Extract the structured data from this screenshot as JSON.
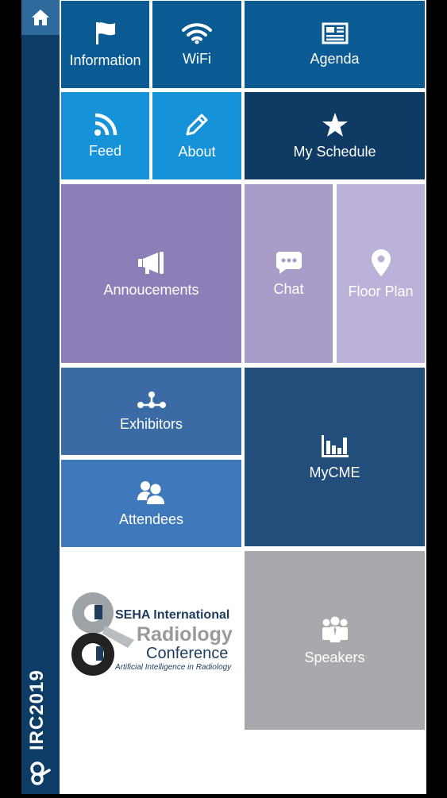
{
  "app": {
    "sidebar_title": "IRC2019"
  },
  "tiles": {
    "information": "Information",
    "wifi": "WiFi",
    "agenda": "Agenda",
    "feed": "Feed",
    "about": "About",
    "my_schedule": "My Schedule",
    "announcements": "Annoucements",
    "chat": "Chat",
    "floor_plan": "Floor Plan",
    "exhibitors": "Exhibitors",
    "mycme": "MyCME",
    "attendees": "Attendees",
    "speakers": "Speakers"
  },
  "logo": {
    "line1": "SEHA International",
    "line2": "Radiology",
    "line3": "Conference",
    "tagline": "Artificial Intelligence in Radiology"
  },
  "icons": {
    "home": "home-icon",
    "information": "flag-icon",
    "wifi": "wifi-icon",
    "agenda": "newspaper-icon",
    "feed": "rss-icon",
    "about": "pencil-icon",
    "my_schedule": "star-icon",
    "announcements": "megaphone-icon",
    "chat": "chat-bubble-icon",
    "floor_plan": "map-pin-icon",
    "exhibitors": "network-icon",
    "mycme": "bar-chart-icon",
    "attendees": "users-icon",
    "speakers": "group-icon"
  },
  "colors": {
    "sidebar": "#0d3c66",
    "home_button": "#2f6a9c",
    "dark_blue": "#0a5a94",
    "bright_blue": "#1592d8",
    "navy": "#0e3a63",
    "lavender_dark": "#8c7fb8",
    "lavender_mid": "#a89dc8",
    "lavender_light": "#bcb1d8",
    "steel_blue": "#3b6ba5",
    "mid_blue": "#3f78bb",
    "slate_navy": "#234d7b",
    "gray": "#a9a9ad"
  }
}
